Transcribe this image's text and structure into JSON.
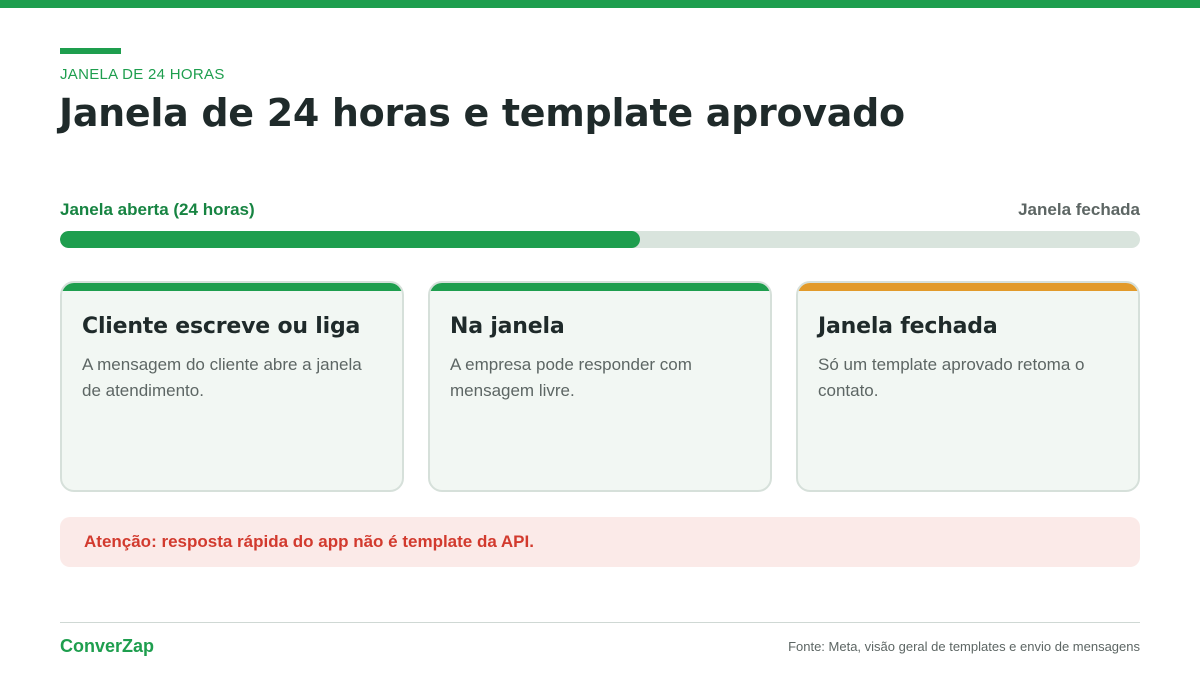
{
  "header": {
    "eyebrow": "JANELA DE 24 HORAS",
    "title": "Janela de 24 horas e template aprovado"
  },
  "progress": {
    "left_label": "Janela aberta (24 horas)",
    "right_label": "Janela fechada",
    "value_percent": 53.7,
    "fill_color": "#1e9e4e",
    "track_color": "#d9e4dd"
  },
  "cards": [
    {
      "title": "Cliente escreve ou liga",
      "body": "A mensagem do cliente abre a janela de atendimento.",
      "accent_color": "#1e9e4e"
    },
    {
      "title": "Na janela",
      "body": "A empresa pode responder com mensagem livre.",
      "accent_color": "#1e9e4e"
    },
    {
      "title": "Janela fechada",
      "body": "Só um template aprovado retoma o contato.",
      "accent_color": "#e29a2a"
    }
  ],
  "alert": {
    "text": "Atenção: resposta rápida do app não é template da API.",
    "text_color": "#d23a2e",
    "background": "#fbeae8"
  },
  "footer": {
    "brand": "ConverZap",
    "source": "Fonte: Meta, visão geral de templates e envio de mensagens"
  },
  "colors": {
    "brand_green": "#1e9e4e",
    "warning_orange": "#e29a2a"
  }
}
